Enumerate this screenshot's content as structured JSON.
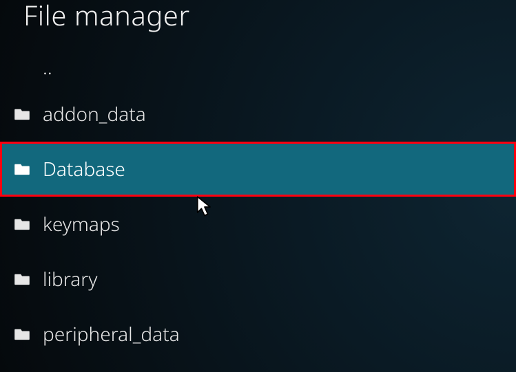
{
  "header": {
    "title": "File manager"
  },
  "list": {
    "parent_label": "..",
    "items": [
      {
        "name": "addon_data",
        "highlighted": false
      },
      {
        "name": "Database",
        "highlighted": true
      },
      {
        "name": "keymaps",
        "highlighted": false
      },
      {
        "name": "library",
        "highlighted": false
      },
      {
        "name": "peripheral_data",
        "highlighted": false
      }
    ]
  },
  "colors": {
    "highlight_bg": "#12687d",
    "highlight_outline": "#ff0010"
  }
}
